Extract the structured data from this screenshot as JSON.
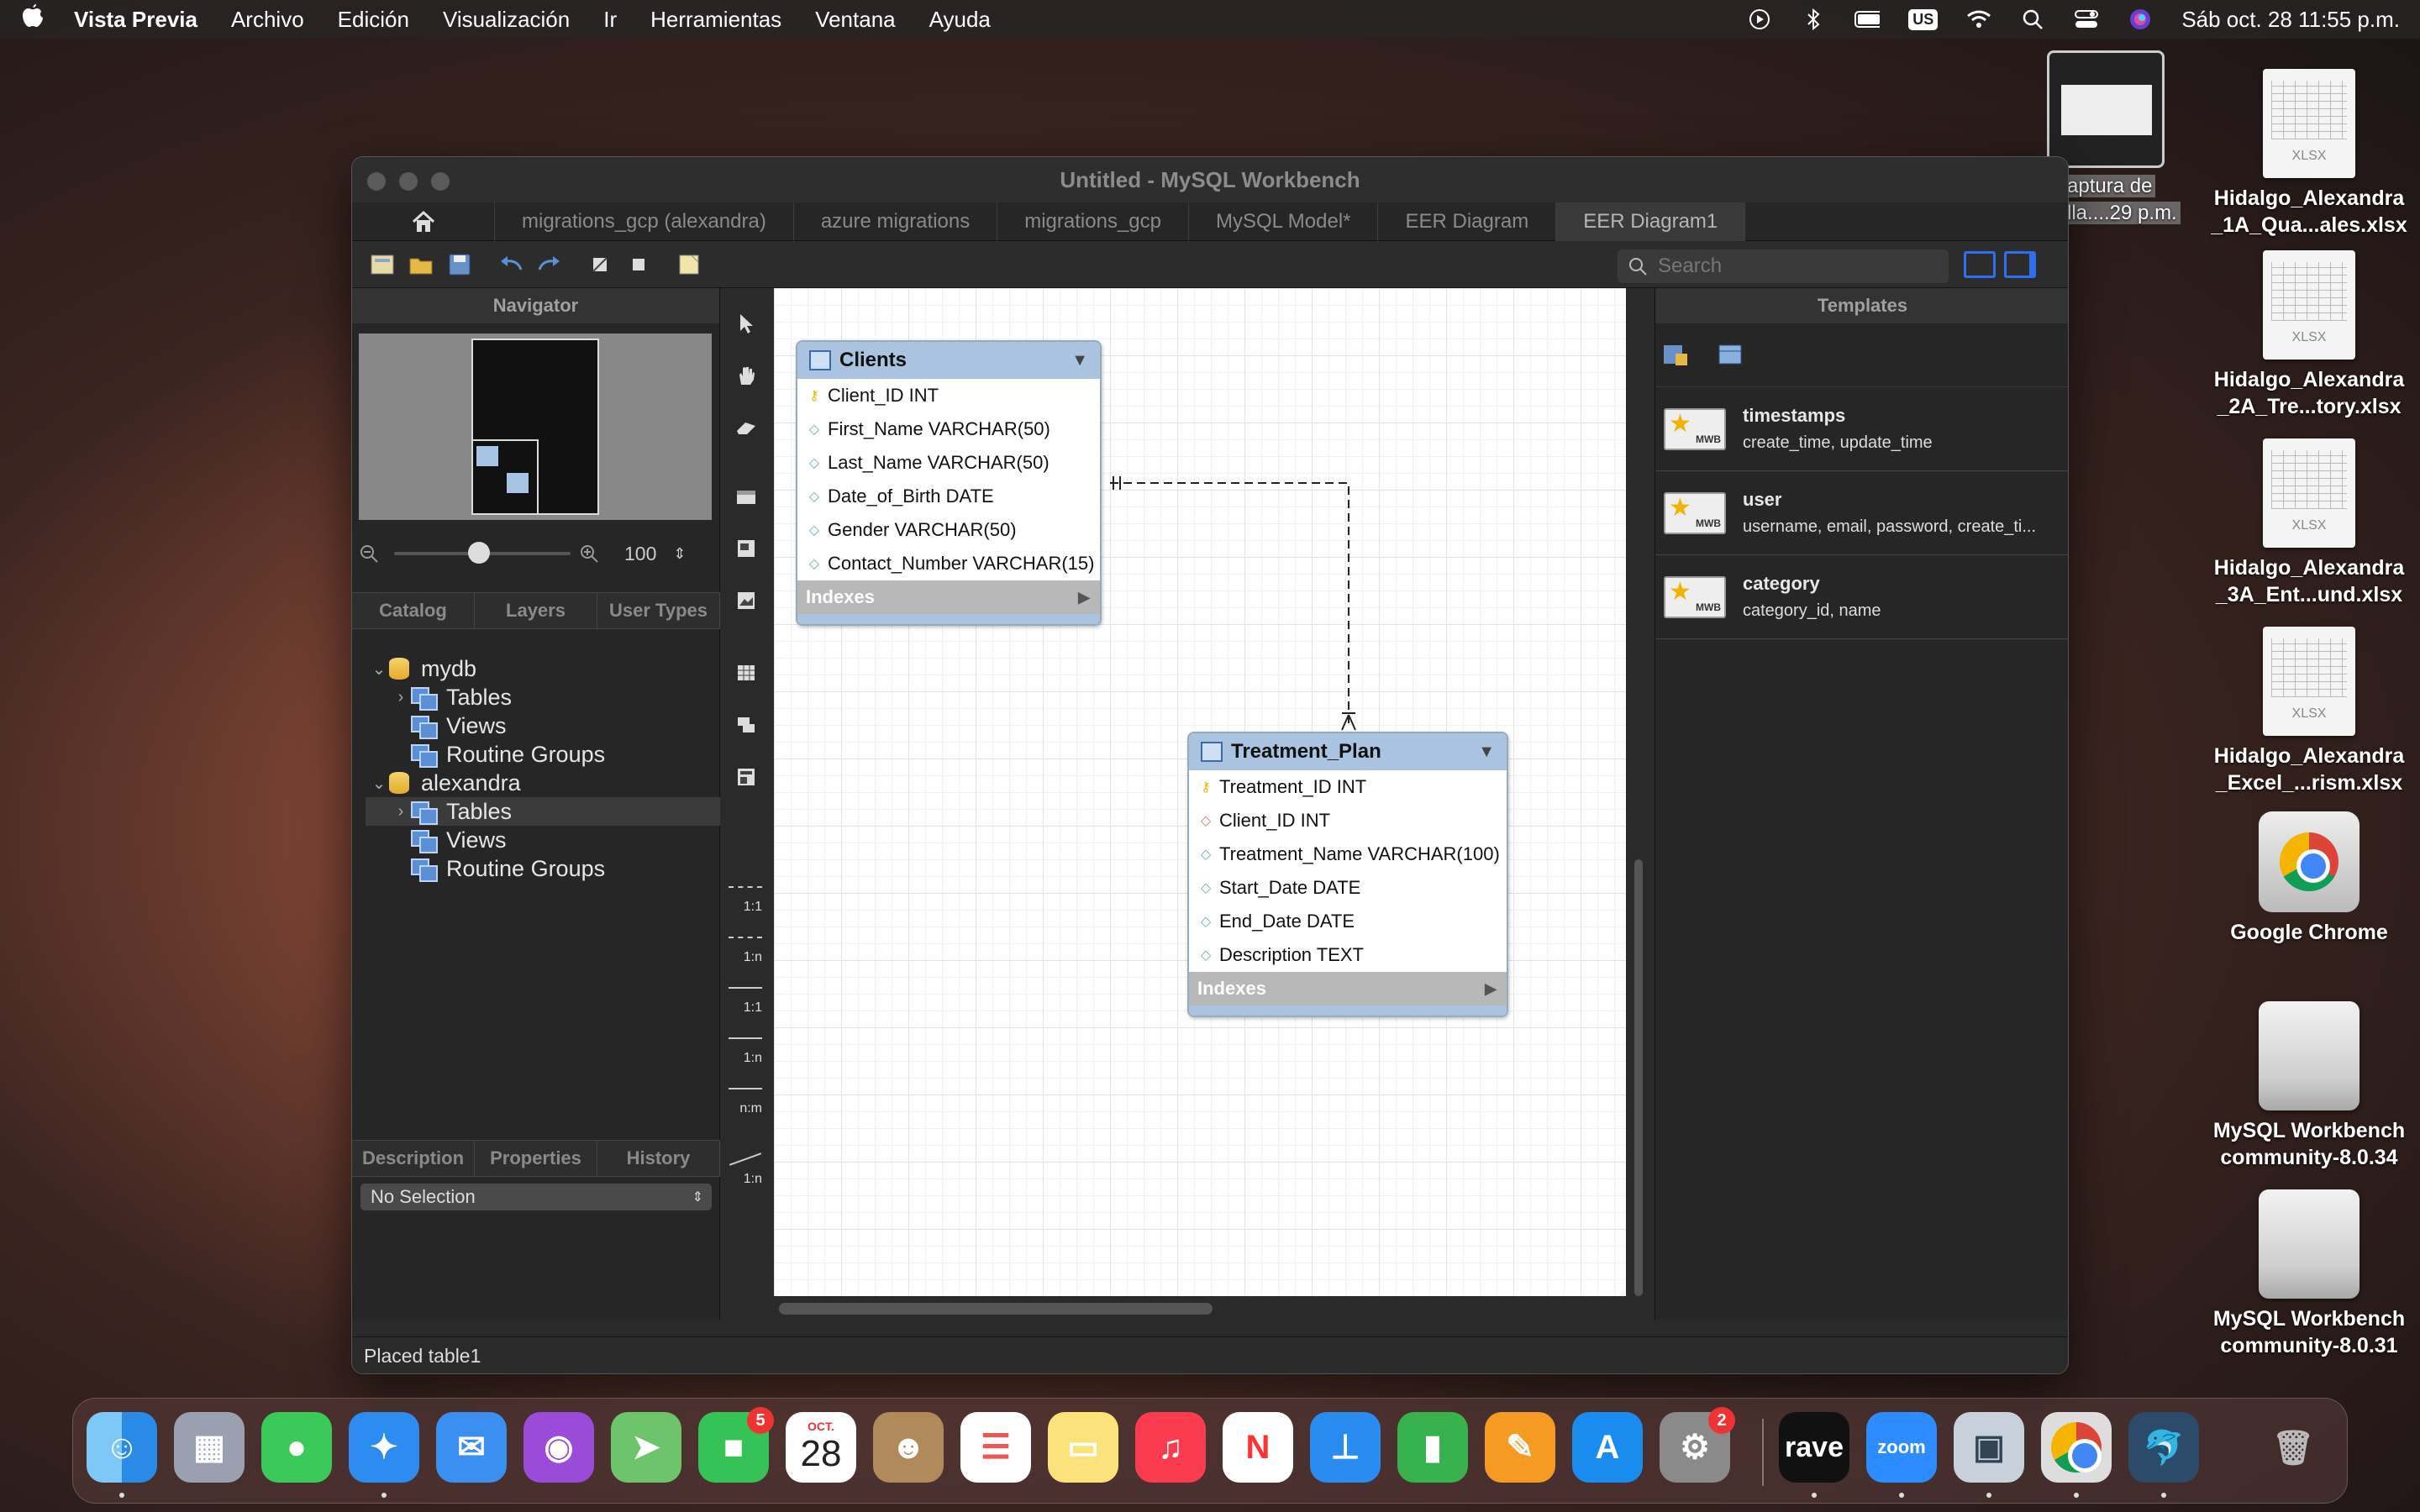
{
  "menubar": {
    "app_name": "Vista Previa",
    "items": [
      "Archivo",
      "Edición",
      "Visualización",
      "Ir",
      "Herramientas",
      "Ventana",
      "Ayuda"
    ],
    "keyboard_badge": "US",
    "datetime": "Sáb oct. 28  11:55 p.m."
  },
  "desktop": {
    "screenshot_label_line1": "aptura de",
    "screenshot_label_line2": "lla....29 p.m.",
    "icons": [
      {
        "label": "Hidalgo_Alexandra _1A_Qua...ales.xlsx",
        "kind": "xlsx"
      },
      {
        "label": "Hidalgo_Alexandra _2A_Tre...tory.xlsx",
        "kind": "xlsx"
      },
      {
        "label": "Hidalgo_Alexandra _3A_Ent...und.xlsx",
        "kind": "xlsx"
      },
      {
        "label": "Hidalgo_Alexandra _Excel_...rism.xlsx",
        "kind": "xlsx"
      },
      {
        "label": "Google Chrome",
        "kind": "chrome"
      },
      {
        "label": "MySQL Workbench community-8.0.34",
        "kind": "drive"
      },
      {
        "label": "MySQL Workbench community-8.0.31",
        "kind": "drive"
      }
    ],
    "xlsx_tag": "XLSX"
  },
  "window": {
    "title": "Untitled - MySQL Workbench",
    "tabs": [
      {
        "label": "migrations_gcp (alexandra)"
      },
      {
        "label": "azure migrations"
      },
      {
        "label": "migrations_gcp"
      },
      {
        "label": "MySQL Model*"
      },
      {
        "label": "EER Diagram"
      },
      {
        "label": "EER Diagram1"
      }
    ],
    "search_placeholder": "Search",
    "status": "Placed table1"
  },
  "left_panel": {
    "navigator_title": "Navigator",
    "zoom_value": "100",
    "catalog_tabs": [
      "Catalog",
      "Layers",
      "User Types"
    ],
    "tree": [
      {
        "label": "mydb",
        "type": "db",
        "level": 0,
        "expanded": true
      },
      {
        "label": "Tables",
        "type": "group",
        "level": 1,
        "expanded": false
      },
      {
        "label": "Views",
        "type": "group",
        "level": 1
      },
      {
        "label": "Routine Groups",
        "type": "group",
        "level": 1
      },
      {
        "label": "alexandra",
        "type": "db",
        "level": 0,
        "expanded": true
      },
      {
        "label": "Tables",
        "type": "group",
        "level": 1,
        "expanded": false,
        "selected": true
      },
      {
        "label": "Views",
        "type": "group",
        "level": 1
      },
      {
        "label": "Routine Groups",
        "type": "group",
        "level": 1
      }
    ],
    "detail_tabs": [
      "Description",
      "Properties",
      "History"
    ],
    "selection": "No Selection"
  },
  "palette": {
    "relations": [
      "1:1",
      "1:n",
      "1:1",
      "1:n",
      "n:m",
      "1:n"
    ]
  },
  "diagram": {
    "entities": [
      {
        "name": "Clients",
        "columns": [
          {
            "text": "Client_ID INT",
            "key": "pk"
          },
          {
            "text": "First_Name VARCHAR(50)",
            "key": "col"
          },
          {
            "text": "Last_Name VARCHAR(50)",
            "key": "col"
          },
          {
            "text": "Date_of_Birth DATE",
            "key": "col"
          },
          {
            "text": "Gender VARCHAR(50)",
            "key": "col"
          },
          {
            "text": "Contact_Number VARCHAR(15)",
            "key": "col"
          }
        ],
        "indexes_label": "Indexes"
      },
      {
        "name": "Treatment_Plan",
        "columns": [
          {
            "text": "Treatment_ID INT",
            "key": "pk"
          },
          {
            "text": "Client_ID INT",
            "key": "fk"
          },
          {
            "text": "Treatment_Name VARCHAR(100)",
            "key": "col"
          },
          {
            "text": "Start_Date DATE",
            "key": "col"
          },
          {
            "text": "End_Date DATE",
            "key": "col"
          },
          {
            "text": "Description TEXT",
            "key": "col"
          }
        ],
        "indexes_label": "Indexes"
      }
    ]
  },
  "right_panel": {
    "title": "Templates",
    "templates": [
      {
        "name": "timestamps",
        "columns": "create_time, update_time"
      },
      {
        "name": "user",
        "columns": "username, email, password, create_ti..."
      },
      {
        "name": "category",
        "columns": "category_id, name"
      }
    ],
    "badge_text": "MWB"
  },
  "dock": {
    "facetime_badge": "5",
    "calendar_month": "OCT.",
    "calendar_day": "28",
    "settings_badge": "2",
    "rave_label": "rave",
    "zoom_label": "zoom"
  },
  "colors": {
    "accent": "#2e6ff2",
    "entity_header": "#a9c3e0",
    "pk_key": "#e8b800"
  }
}
